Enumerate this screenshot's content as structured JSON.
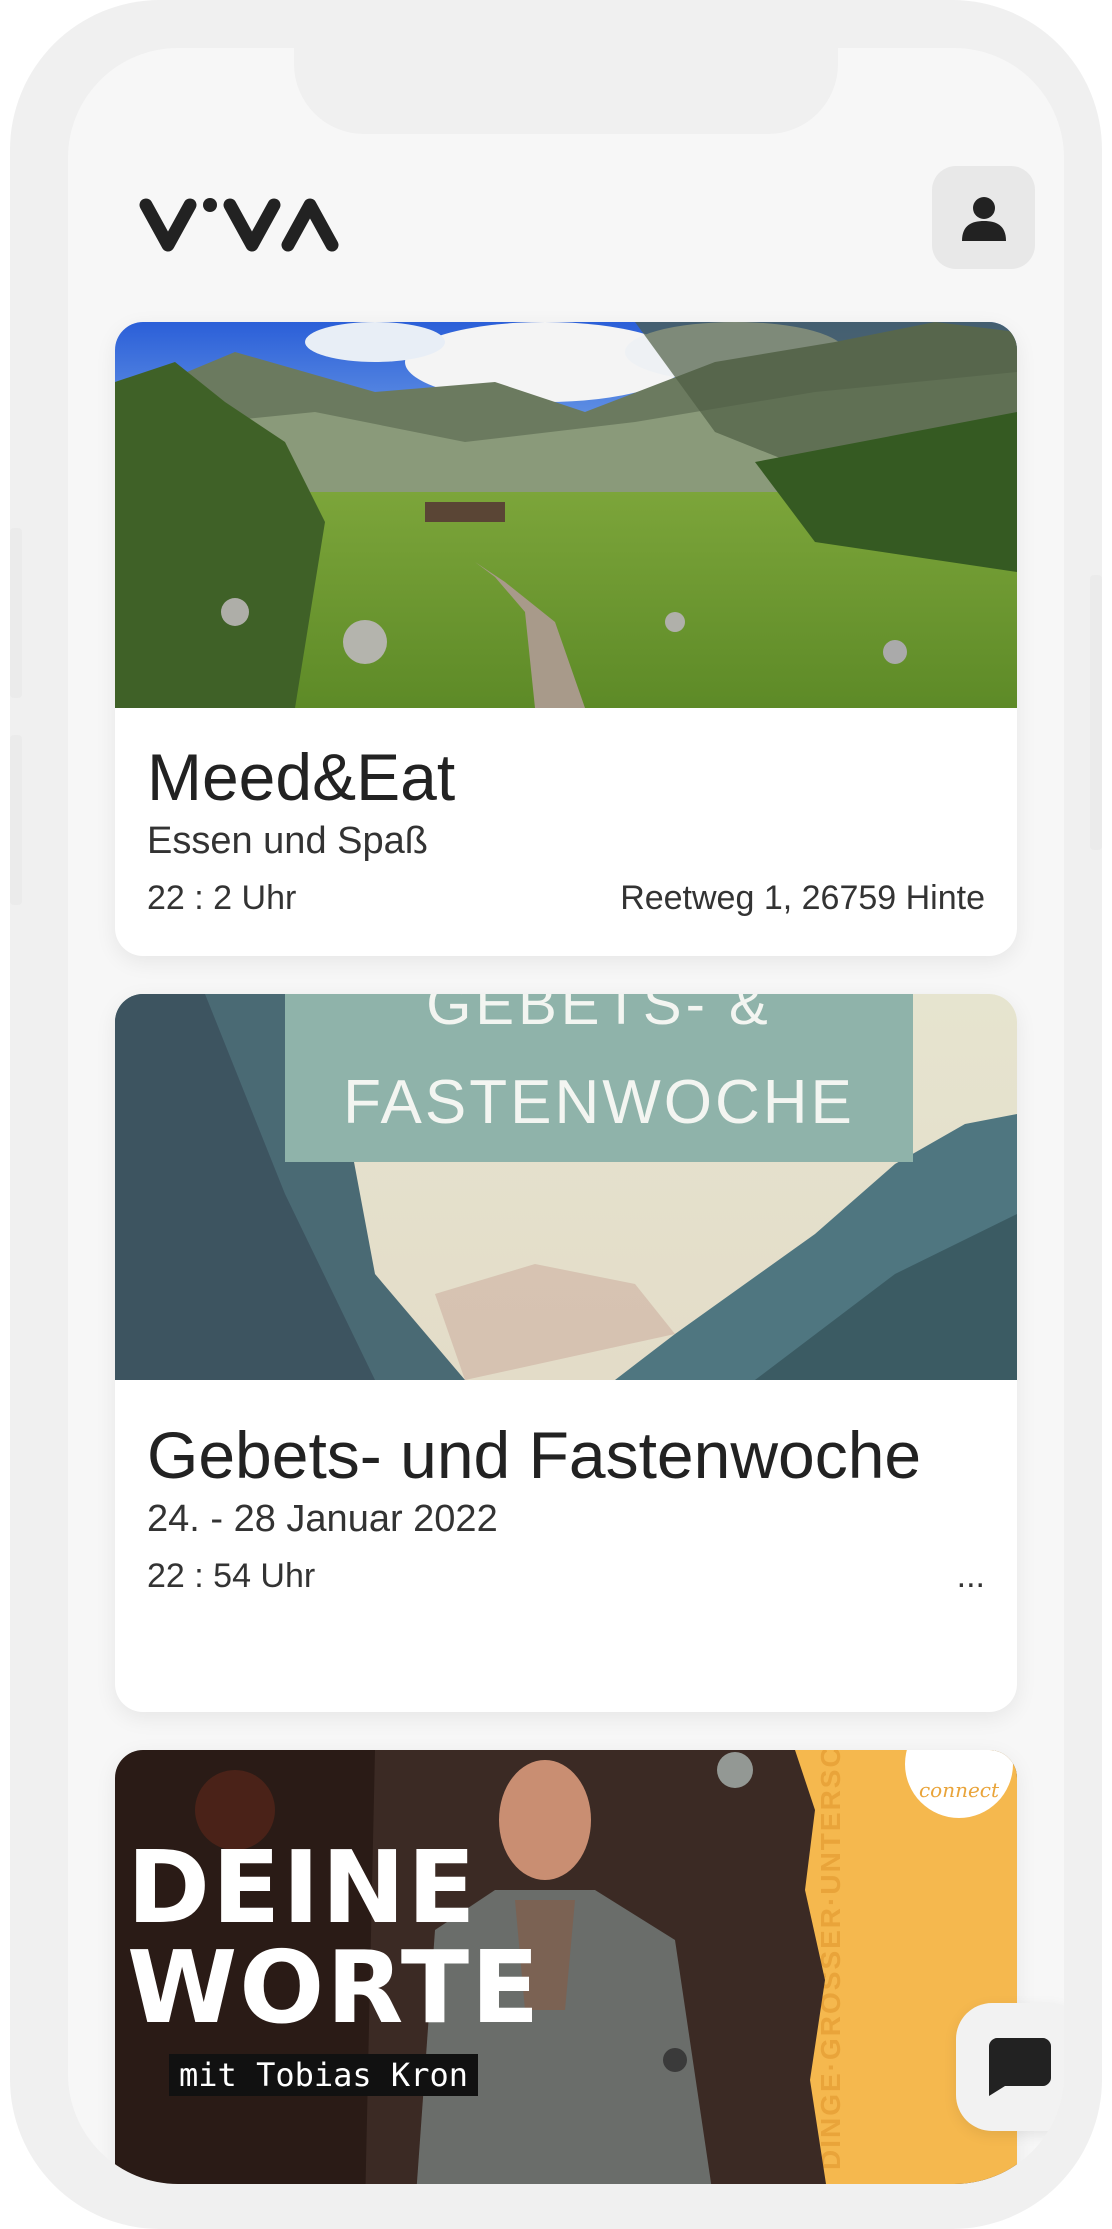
{
  "app": {
    "logo_text": "V·VA"
  },
  "events": [
    {
      "title": "Meed&Eat",
      "subtitle": "Essen und Spaß",
      "time": "22 : 2 Uhr",
      "location": "Reetweg 1, 26759 Hinte"
    },
    {
      "title": "Gebets- und Fastenwoche",
      "subtitle": "24. - 28 Januar 2022",
      "time": "22 : 54 Uhr",
      "location": "...",
      "image_text_line1": "GEBETS- &",
      "image_text_line2": "FASTENWOCHE"
    },
    {
      "image_text_line1": "DEINE",
      "image_text_line2": "WORTE",
      "image_caption": "mit Tobias Kron",
      "image_badge": "connect",
      "image_side_text": "DINGE·GRÖSSER·UNTERSC"
    }
  ],
  "icons": {
    "profile": "person-icon",
    "chat": "chat-bubble-icon"
  },
  "colors": {
    "accent_yellow": "#f5b84e",
    "teal_banner": "#8fb3aa",
    "text_dark": "#222222"
  }
}
